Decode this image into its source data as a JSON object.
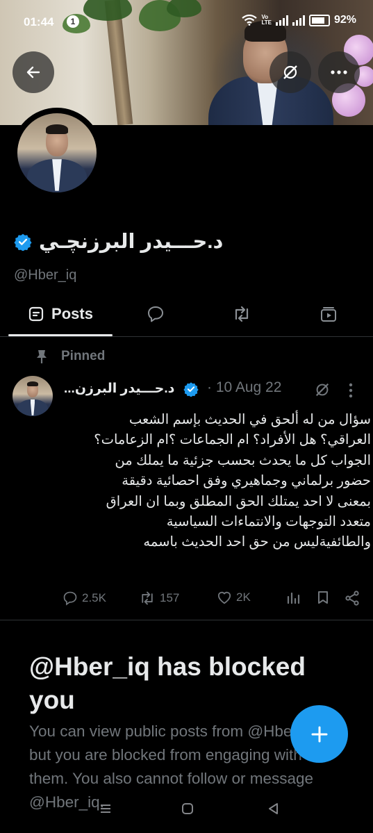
{
  "status_bar": {
    "time": "01:44",
    "notification_count": "1",
    "network_label_1": "Vo",
    "network_label_2": "LTE",
    "battery": "92%"
  },
  "profile": {
    "display_name": "د.حـــيدر البرزنچـي",
    "handle": "@Hber_iq",
    "verified": true
  },
  "tabs": [
    {
      "label": "Posts",
      "icon": "posts-icon",
      "active": true
    },
    {
      "label": "",
      "icon": "replies-icon"
    },
    {
      "label": "",
      "icon": "reposts-icon"
    },
    {
      "label": "",
      "icon": "media-icon"
    }
  ],
  "pinned_post": {
    "pinned_label": "Pinned",
    "author_name": "د.حـــيدر البرزن...",
    "date": "· 10 Aug 22",
    "text": "سؤال من له ألحق في الحديث بإسم الشعب\nالعراقي؟ هل الأفراد؟ ام الجماعات ؟ام الزعامات؟\nالجواب كل ما يحدث بحسب جزئية ما يملك من\nحضور برلماني وجماهيري وفق احصائية دقيقة\nبمعنى لا احد يمتلك الحق المطلق وبما ان العراق\nمتعدد التوجهات والانتماءات السياسية\nوالطائفيةليس من حق احد الحديث باسمه",
    "stats": {
      "replies": "2.5K",
      "reposts": "157",
      "likes": "2K"
    }
  },
  "blocked_notice": {
    "title": "@Hber_iq has blocked you",
    "body": "You can view public posts from @Hber_iq, but you are blocked from engaging with them. You also cannot follow or message @Hber_iq."
  },
  "colors": {
    "accent": "#1d9bf0",
    "background": "#000000",
    "text_primary": "#e7e9ea",
    "text_secondary": "#71767b"
  }
}
